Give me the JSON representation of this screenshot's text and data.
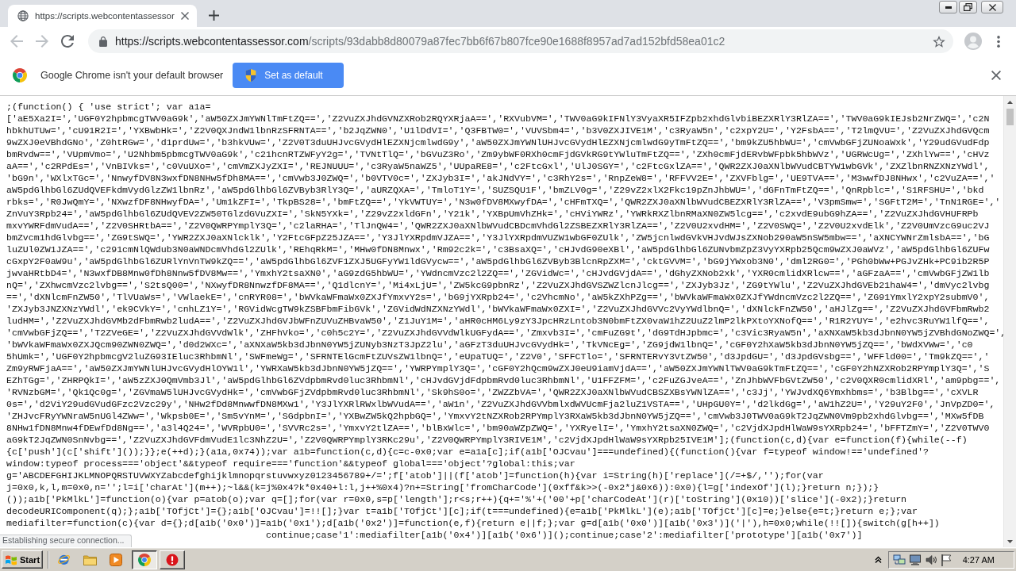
{
  "window": {
    "tabs": [
      {
        "title": "https://scripts.webcontentassessor",
        "selected": true
      }
    ]
  },
  "toolbar": {
    "nav_buttons": [
      {
        "kind": "back",
        "disabled": true
      },
      {
        "kind": "forward",
        "disabled": true
      },
      {
        "kind": "reload",
        "disabled": false
      }
    ],
    "url": {
      "origin": "https://scripts.webcontentassessor.com",
      "path": "/scripts/93dabb8d80079a87fec7bb6f67b807fce90e1688f8957ad7ad152bfd58ea01c2"
    }
  },
  "infobar": {
    "message": "Google Chrome isn't your default browser",
    "button": "Set as default"
  },
  "page": {
    "code_lines": [
      ";(function() { 'use strict'; var a1a=",
      "['aE5Xa2I=','UGF0Y2hpbmcgTWV0aG9k','aW50ZXJmYWNlTmFtZQ==','Z2VuZXJhdGVNZXRob2RQYXRjaA==','RXVubVM=','TWV0aG9kIFNlY3VyaXR5IFZpb2xhdGlvbiBEZXRlY3RlZA==','TWV0aG9kIEJsb2NrZWQ=','c2N",
      "hbkhUTUw=','cU91R2I=','YXBwbHk=','Z2V0QXJndW1lbnRzSFRNTA==','b2JqZWN0','U1lDdVI=','Q3FBTW0=','VUVSbm4=','b3V0ZXJIVE1M','c3RyaW5n','c2xpY2U=','Y2FsbA==','T2lmQVU=','Z2VuZXJhdGVQcm",
      "9wZXJ0eVBhdGNo','Z0htRGw=','d1prdUw=','b3hkVUw=','Z2V0T3duUHJvcGVydHlEZXNjcmlwdG9y','aW50ZXJmYWNlUHJvcGVydHlEZXNjcmlwdG9yTmFtZQ==','bm9kZU5hbWU=','cmVwbGFjZUNoaWxk','Y29udGVudFdp",
      "bmRvdw==','VUpmVmo=','U2Nhbm5pbmcgTWV0aG9k','c21hcnRTZWFyY2g=','TVNtTlQ=','bGVuZ3Ro','Zm9ybWF0RXh0cmFjdGVkRG9tYWluTmFtZQ==','ZXh0cmFjdERvbWFpbk5hbWVz','UGRWcUg=','ZXhlYw==','cHVz",
      "aA==','c2RPdEs=','VnBIVks=','c0VuUXo=','cmVmZXJyZXI=','REJNUUU=','c3RyaW5naWZ5','UUpaRE8=','c2FtcGxl','UlJ0SGY=','c2FtcGxlZA==','QWR2ZXJ0aXNlbWVudCBTYW1wbGVk','ZXZlbnRNZXNzYWdl',",
      "'bG9n','WXlxTGc=','NnwyfDV8N3wxfDN8NHw5fDh8MA==','cmVwb3J0ZWQ=','b0VTV0c=','ZXJyb3I=','akJNdVY=','c3RhY2s=','RnpZeW8=','RFFVV2E=','ZXVFblg=','UE9TVA==','M3wwfDJ8NHwx','c2VuZA==','",
      "aW5pdGlhbGl6ZUdQVEFkdmVydGlzZW1lbnRz','aW5pdGlhbGl6ZVByb3RlY3Q=','aURZQXA=','TmloT1Y=','SUZSQU1F','bmZLV0g=','Z29vZ2xlX2Fkc19pZnJhbWU=','dGFnTmFtZQ==','QnRpblc=','S1RFSHU=','bkd",
      "rbks=','R0JwQmY=','NXwzfDF8NHwyfDA=','Um1kZFI=','TkpBS28=','bmFtZQ==','YkVWTUY=','N3w0fDV8MXwyfDA=','cHFmTXQ=','QWR2ZXJ0aXNlbWVudCBEZXRlY3RlZA==','V3pmSmw=','SGFtT2M=','TnN1RGE=','",
      "ZnVuY3Rpb24=','aW5pdGlhbGl6ZUdQVEV2ZW50TGlzdGVuZXI=','SkN5YXk=','Z29vZ2xldGFn','Y21k','YXBpUmVhZHk=','cHViYWRz','YWRkRXZlbnRMaXN0ZW5lcg==','c2xvdE9ubG9hZA==','Z2VuZXJhdGVHUFRPb",
      "mxvYWRFdmVudA==','Z2V0SHRtbA==','Z2V0QWRPYmplY3Q=','c2laRHA=','TlJnQW4=','QWR2ZXJ0aXNlbWVudCBDcmVhdGl2ZSBEZXRlY3RlZA==','Z2V0U2xvdHM=','Z2V0SWQ=','Z2V0U2xvdElk','Z2V0UmVzcG9uc2VJ",
      "bmZvcm1hdGlvbg==','ZG9tSWQ=','YWR2ZXJ0aXNlcklk','Y2FtcGFpZ25JZA==','Y3JlYXRpdmVJZA==','Y3JlYXRpdmVUZW1wbGF0ZUlk','ZW5jcnlwdGVkVHJvdWJsZXNob290aW5nSW5mbw==','aXNCYWNrZmlsbA==','bG",
      "luZUl0ZW1JZA==','c291cmNlQWdub3N0aWNDcmVhdGl2ZUlk','REhqRkM=','MHw0fDN8Mnwx','Rm92c2k=','c3BsaXQ=','cHJvdG90eXBl','aW5pdGlhbGl6ZUNvbmZpZ3VyYXRpb25Qcm9wZXJ0aWVz','aW5pdGlhbGl6ZUFw",
      "cGxpY2F0aW9u','aW5pdGlhbGl6ZURlYnVnTW9kZQ==','aW5pdGlhbGl6ZVF1ZXJ5UGFyYW1ldGVycw==','aW5pdGlhbGl6ZVByb3BlcnRpZXM=','cktGVVM=','bG9jYWxob3N0','dml2RG0=','PGh0bWw+PGJvZHk+PC9ib2R5P",
      "jwvaHRtbD4=','N3wxfDB8Mnw0fDh8Nnw5fDV8Mw==','YmxhY2tsaXN0','aG9zdG5hbWU=','YWdncmVzc2l2ZQ==','ZGVidWc=','cHJvdGVjdA==','dGhyZXNob2xk','YXR0cmlidXRlcw==','aGFzaA==','cmVwbGFjZW1lb",
      "nQ=','ZXhwcmVzc2lvbg==','S2tsQ00=','NXwyfDR8NnwzfDF8MA==','Q1dlcnY=','Mi4xLjU=','ZW5kcG9pbnRz','Z2VuZXJhdGVSZWZlcnJlcg==','ZXJyb3Jz','ZG9tYWlu','Z2VuZXJhdGVEb21haW4=','dmVyc2lvbg",
      "==','dXNlcmFnZW50','TlVUaWs=','VWlaekE=','cnRYR08=','bWVkaWFmaWx0ZXJfYmxvY2s=','bG9jYXRpb24=','c2VhcmNo','aW5kZXhPZg==','bWVkaWFmaWx0ZXJfYWdncmVzc2l2ZQ==','ZG91YmxlY2xpY2submV0',",
      "'ZXJyb3JNZXNzYWdl','ek9CVkY=','cnhLZ1Y=','RGVidWcgTW9kZSBFbmFibGVk','ZGVidWdNZXNzYWdl','bWVkaWFmaWx0ZXI=','Z2VuZXJhdGVVc2VyYWdlbnQ=','dXNlckFnZW50','aHJlZg==','Z2VuZXJhdGVFbmRwb2",
      "ludHM=','Z2VuZXJhdGVMb2dFbmRwb2ludA==','Z2VuZXJhdGVJbWFnZUVuZHBvaW50','Z1JuY1M=','aHR0cHM6Ly9zY3JpcHRzLntob3N0bmFtZX0vaW1hZ2UuZ2lmP2lkPXtoYXNofQ==','R1R2YUY=','e2hvc3RuYW1lfQ==',",
      "'cmVwbGFjZQ==','T2ZVeGE=','Z2VuZXJhdGVVdWlk','ZHFhVko=','c0h5c2Y=','Z2VuZXJhdGVVdWlkUGFydA==','Zmxvb3I=','cmFuZG9t','dG9TdHJpbmc=','c3Vic3RyaW5n','aXNXaW5kb3dJbnN0YW5jZVBhdGNoZWQ=',",
      "'bWVkaWFmaWx0ZXJQcm90ZWN0ZWQ=','d0d2WXc=','aXNXaW5kb3dJbnN0YW5jZUNyb3NzT3JpZ2lu','aGFzT3duUHJvcGVydHk=','TkVNcEg=','ZG9jdW1lbnQ=','cGF0Y2hXaW5kb3dJbnN0YW5jZQ==','bWdXVWw=','c0",
      "5hUmk=','UGF0Y2hpbmcgV2luZG93IEluc3RhbmNl','SWFmeWg=','SFRNTElGcmFtZUVsZW1lbnQ=','eUpaTUQ=','Z2V0','SFFCTlo=','SFRNTERvY3VtZW50','d3JpdGU=','d3JpdGVsbg==','WFFld00=','Tm9kZQ==','",
      "Zm9yRWFjaA==','aW50ZXJmYWNlUHJvcGVydHlOYW1l','YWRXaW5kb3dJbnN0YW5jZQ==','YWRPYmplY3Q=','cGF0Y2hQcm9wZXJ0eU9iamVjdA==','aW50ZXJmYWNlTWV0aG9kTmFtZQ==','cGF0Y2hNZXRob2RPYmplY3Q=','S",
      "EZhTGg=','ZHRPQkI=','aW5zZXJ0QmVmb3Jl','aW5pdGlhbGl6ZVdpbmRvd0luc3RhbmNl','cHJvdGVjdFdpbmRvd0luc3RhbmNl','U1FFZFM=','c2FuZGJveA==','ZnJhbWVFbGVtZW50','c2V0QXR0cmlidXRl','am9pbg==',",
      "'RVNzbGM=','Qk1Qc0g=','ZGVmaW5lUHJvcGVydHk=','cmVwbGFjZVdpbmRvd0luc3RhbmNl','Sk9hS0o=','ZWZZbVA=','QWR2ZXJ0aXNlbWVudCBSZXBsYWNlZA==','c3Jj','YWJvdXQ6Ymxhbms=','b3Blbg==','cXVLR",
      "0s=','d2ViY29udGVudGFzc2Vzc29y','NHw2fDd8MnwwfDN8MXw1','Y3JlYXRlRWxlbWVudA==','aW1n','Z2VuZXJhdGVVbmlxdWVUcmFja2luZ1VSTA==','UHpGU0Y=','d2lkdGg=','aW1hZ2U=','Y29uY2F0','JnVpZD0=',",
      "'ZHJvcFRyYWNraW5nUGl4ZWw=','Wkpsb0E=','Sm5vYnM=','SGdpbnI=','YXBwZW5kQ2hpbGQ=','YmxvY2tNZXRob2RPYmplY3RXaW5kb3dJbnN0YW5jZQ==','cmVwb3J0TWV0aG9kT2JqZWN0Vm9pb2xhdGlvbg==','MXw5fDB",
      "8NHw1fDN8Mnw4fDEwfDd8Ng==','a3l4Q24=','WVRpbU0=','SVVRc2s=','YmxvY2tlZA==','blBxWlc=','bm90aWZpZWQ=','YXRyelI=','YmxhY2tsaXN0ZWQ=','c2VjdXJpdHlWaW9sYXRpb24=','bFFTZmY=','Z2V0TWV0",
      "aG9kT2JqZWN0SnNvbg==','Z2VuZXJhdGVFdmVudE1lc3NhZ2U=','Z2V0QWRPYmplY3RKc29u','Z2V0QWRPYmplY3RIVE1M','c2VjdXJpdHlWaW9sYXRpb25IVE1M'];(function(c,d){var e=function(f){while(--f)",
      "{c['push'](c['shift']());}};e(++d);}(a1a,0x74));var a1b=function(c,d){c=c-0x0;var e=a1a[c];if(a1b['OJCvau']===undefined){(function(){var f=typeof window!=='undefined'?",
      "window:typeof process==='object'&&typeof require==='function'&&typeof global==='object'?global:this;var",
      "g='ABCDEFGHIJKLMNOPQRSTUVWXYZabcdefghijklmnopqrstuvwxyz0123456789+/=';f['atob']||(f['atob']=function(h){var i=String(h)['replace'](/=+$/,'');for(var",
      "j=0x0,k,l,m=0x0,n='';l=i['charAt'](m++);~l&&(k=j%0x4?k*0x40+l:l,j++%0x4)?n+=String['fromCharCode'](0xff&k>>(-0x2*j&0x6)):0x0){l=g['indexOf'](l);}return n;});}",
      "());a1b['PkMlkL']=function(o){var p=atob(o);var q=[];for(var r=0x0,s=p['length'];r<s;r++){q+='%'+('00'+p['charCodeAt'](r)['toString'](0x10))['slice'](-0x2);}return",
      "decodeURIComponent(q);};a1b['TOfjCt']={};a1b['OJCvau']=!![];}var t=a1b['TOfjCt'][c];if(t===undefined){e=a1b['PkMlkL'](e);a1b['TOfjCt'][c]=e;}else{e=t;}return e;};var",
      "mediafilter=function(c){var d={};d[a1b('0x0')]=a1b('0x1');d[a1b('0x2')]=function(e,f){return e||f;};var g=d[a1b('0x0')][a1b('0x3')]('|'),h=0x0;while(!![]){switch(g[h++])"
    ],
    "covered_line": "continue;case'1':mediafilter[a1b('0x4')][a1b('0x6')]();continue;case'2':mediafilter['prototype'][a1b('0x7')]"
  },
  "status_bubble": {
    "text": "Establishing secure connection..."
  },
  "taskbar": {
    "start": "Start",
    "quick_launch": [
      {
        "kind": "ie"
      },
      {
        "kind": "folder"
      },
      {
        "kind": "media"
      }
    ],
    "tasks": [
      {
        "kind": "chrome",
        "selected": true
      },
      {
        "kind": "alert",
        "selected": false
      }
    ],
    "clock": "4:27 AM"
  }
}
